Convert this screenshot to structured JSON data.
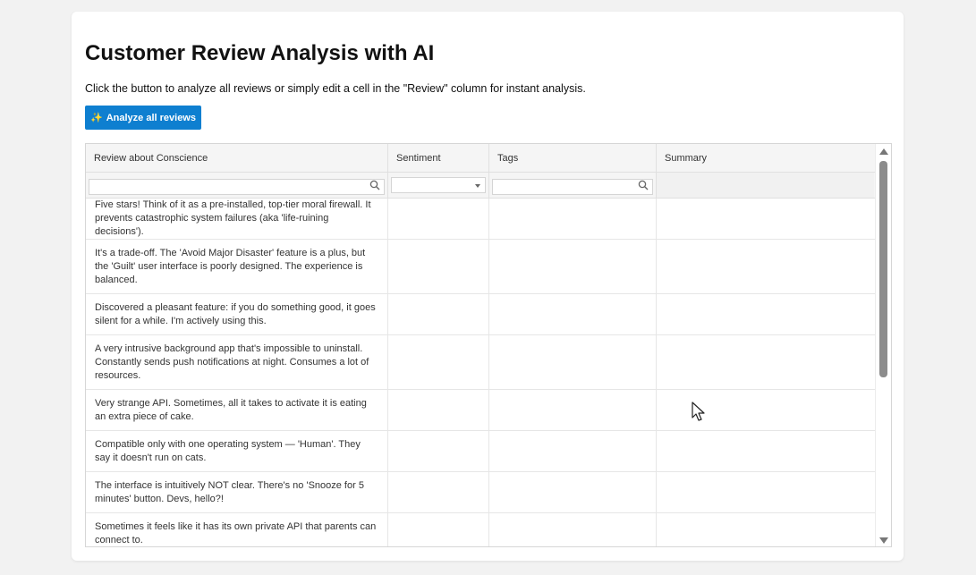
{
  "page": {
    "title": "Customer Review Analysis with AI",
    "description": "Click the button to analyze all reviews or simply edit a cell in the \"Review\" column for instant analysis.",
    "analyze_button": {
      "icon": "sparkles-icon",
      "label": "Analyze all reviews"
    }
  },
  "grid": {
    "columns": [
      "Review about Conscience",
      "Sentiment",
      "Tags",
      "Summary"
    ],
    "filters": {
      "review_placeholder": "",
      "sentiment_value": "",
      "tags_placeholder": ""
    },
    "rows": [
      {
        "review": "Five stars! Think of it as a pre-installed, top-tier moral firewall. It prevents catastrophic system failures (aka 'life-ruining decisions').",
        "sentiment": "",
        "tags": "",
        "summary": ""
      },
      {
        "review": "It's a trade-off. The 'Avoid Major Disaster' feature is a plus, but the 'Guilt' user interface is poorly designed. The experience is balanced.",
        "sentiment": "",
        "tags": "",
        "summary": ""
      },
      {
        "review": "Discovered a pleasant feature: if you do something good, it goes silent for a while. I'm actively using this.",
        "sentiment": "",
        "tags": "",
        "summary": ""
      },
      {
        "review": "A very intrusive background app that's impossible to uninstall. Constantly sends push notifications at night. Consumes a lot of resources.",
        "sentiment": "",
        "tags": "",
        "summary": ""
      },
      {
        "review": "Very strange API. Sometimes, all it takes to activate it is eating an extra piece of cake.",
        "sentiment": "",
        "tags": "",
        "summary": ""
      },
      {
        "review": "Compatible only with one operating system — 'Human'. They say it doesn't run on cats.",
        "sentiment": "",
        "tags": "",
        "summary": ""
      },
      {
        "review": "The interface is intuitively NOT clear. There's no 'Snooze for 5 minutes' button. Devs, hello?!",
        "sentiment": "",
        "tags": "",
        "summary": ""
      },
      {
        "review": "Sometimes it feels like it has its own private API that parents can connect to.",
        "sentiment": "",
        "tags": "",
        "summary": ""
      }
    ]
  },
  "colors": {
    "button": "#0e7fd0",
    "header_bg": "#f5f5f5",
    "page_bg": "#f2f2f2"
  }
}
